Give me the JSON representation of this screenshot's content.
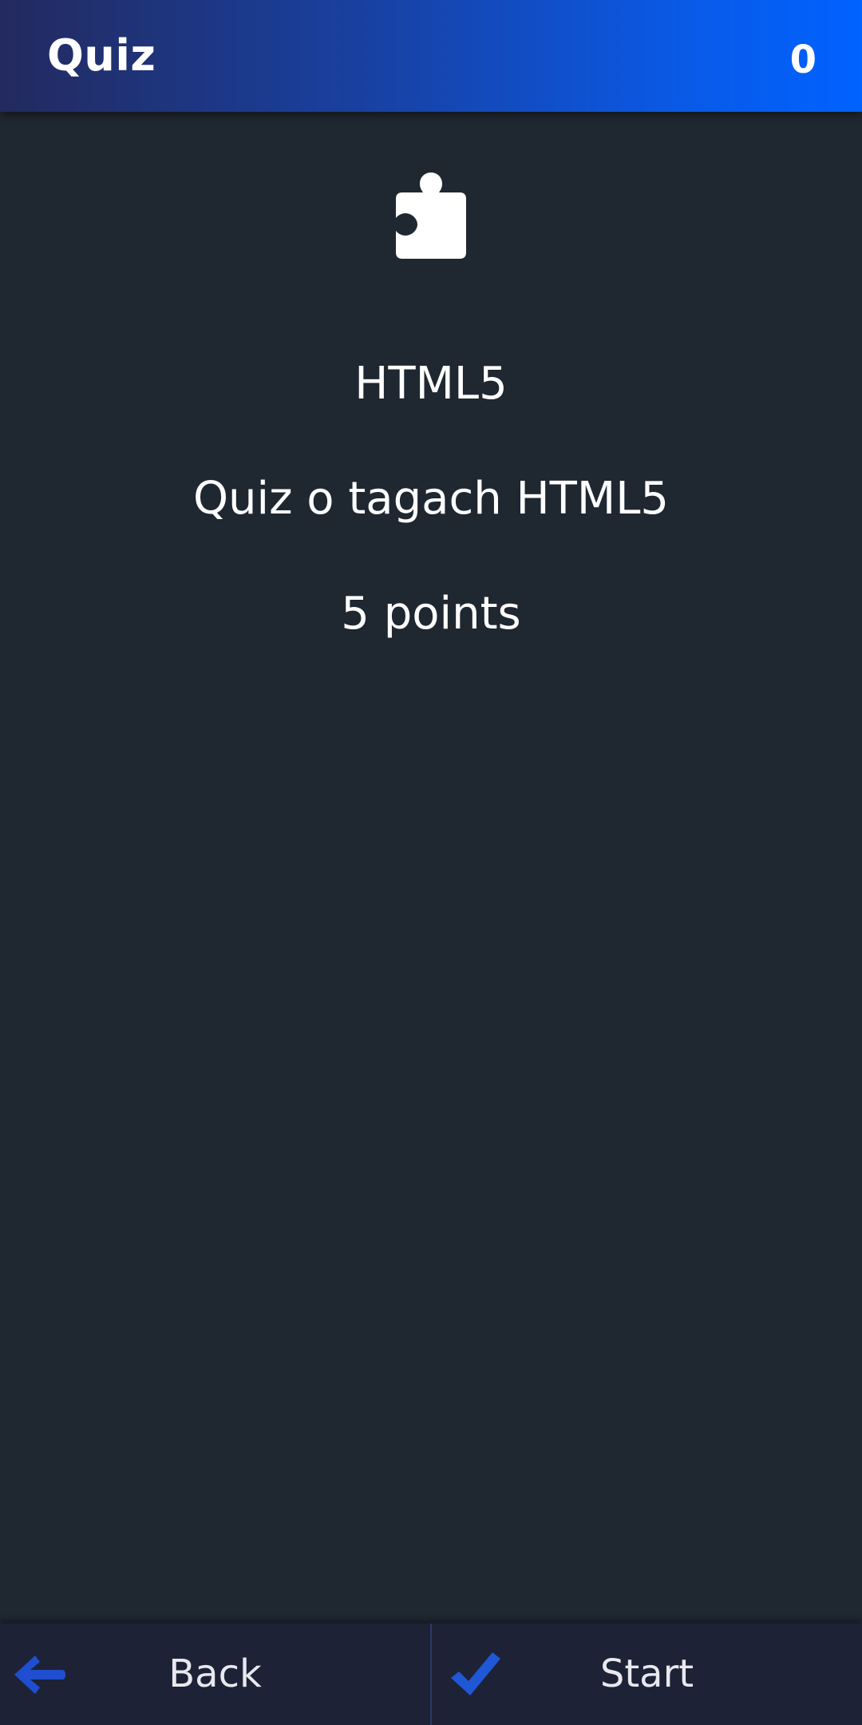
{
  "header": {
    "title": "Quiz",
    "score": "0"
  },
  "quiz": {
    "icon": "puzzle-piece-icon",
    "name": "HTML5",
    "description": "Quiz o tagach HTML5",
    "points": "5 points"
  },
  "bottom_bar": {
    "back_label": "Back",
    "back_icon": "arrow-left-icon",
    "start_label": "Start",
    "start_icon": "checkmark-icon"
  },
  "colors": {
    "background": "#1f2731",
    "header_gradient_start": "#232a5e",
    "header_gradient_end": "#0062ff",
    "bottom_bar": "#1e2236",
    "icon_accent": "#1f57d6"
  }
}
